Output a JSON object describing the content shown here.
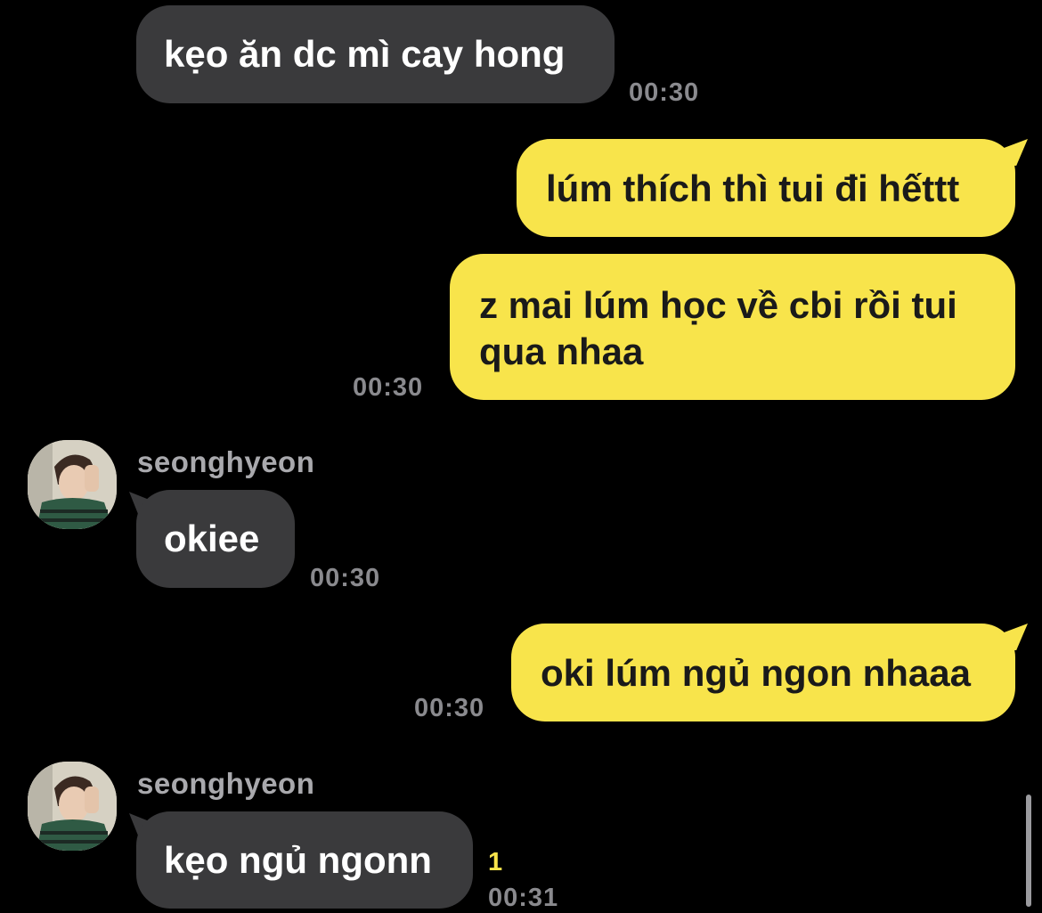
{
  "chat": {
    "messages": [
      {
        "direction": "incoming",
        "text": "kẹo ăn dc mì cay hong",
        "time": "00:30"
      },
      {
        "direction": "outgoing",
        "text": "lúm thích thì tui đi hếttt"
      },
      {
        "direction": "outgoing",
        "text": "z mai lúm học về cbi rồi tui qua nhaa",
        "time": "00:30"
      },
      {
        "direction": "incoming",
        "sender": "seonghyeon",
        "text": "okiee",
        "time": "00:30"
      },
      {
        "direction": "outgoing",
        "text": "oki lúm ngủ ngon nhaaa",
        "time": "00:30"
      },
      {
        "direction": "incoming",
        "sender": "seonghyeon",
        "text": "kẹo ngủ ngonn",
        "unread_count": "1",
        "time": "00:31"
      }
    ]
  },
  "colors": {
    "background": "#000000",
    "incoming_bubble": "#3a3a3c",
    "outgoing_bubble": "#f8e44b",
    "timestamp": "#8a8a8e",
    "unread": "#f8e44b"
  },
  "icons": {
    "avatar": "profile-photo"
  }
}
